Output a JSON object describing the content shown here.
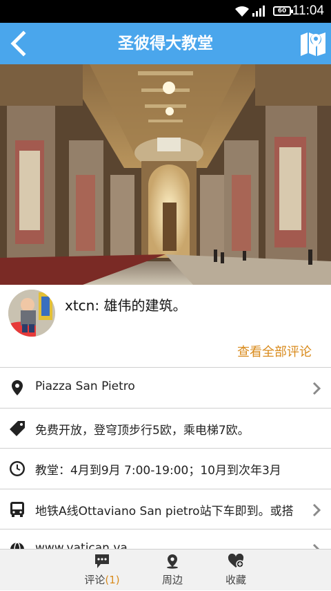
{
  "status_bar": {
    "time": "11:04",
    "battery_level": "60"
  },
  "app_bar": {
    "title": "圣彼得大教堂",
    "icons": [
      "back-arrow-icon",
      "map-icon"
    ]
  },
  "hero": {
    "image": "St. Peter's Basilica interior nave",
    "page_indicator": {
      "count": 1,
      "active": 0
    }
  },
  "review": {
    "text": "xtcn: 雄伟的建筑。",
    "more_link": "查看全部评论"
  },
  "info": {
    "address": "Piazza San Pietro",
    "price": "免费开放，登穹顶步行5欧，乘电梯7欧。",
    "hours": "教堂：4月到9月 7:00-19:00；10月到次年3月",
    "transport": "地铁A线Ottaviano San pietro站下车即到。或搭",
    "website": "www.vatican.va"
  },
  "tabs": {
    "comments_label": "评论",
    "comments_count": "(1)",
    "nearby_label": "周边",
    "favorite_label": "收藏"
  },
  "colors": {
    "primary": "#4aa6ec",
    "accent": "#d98b1d"
  }
}
